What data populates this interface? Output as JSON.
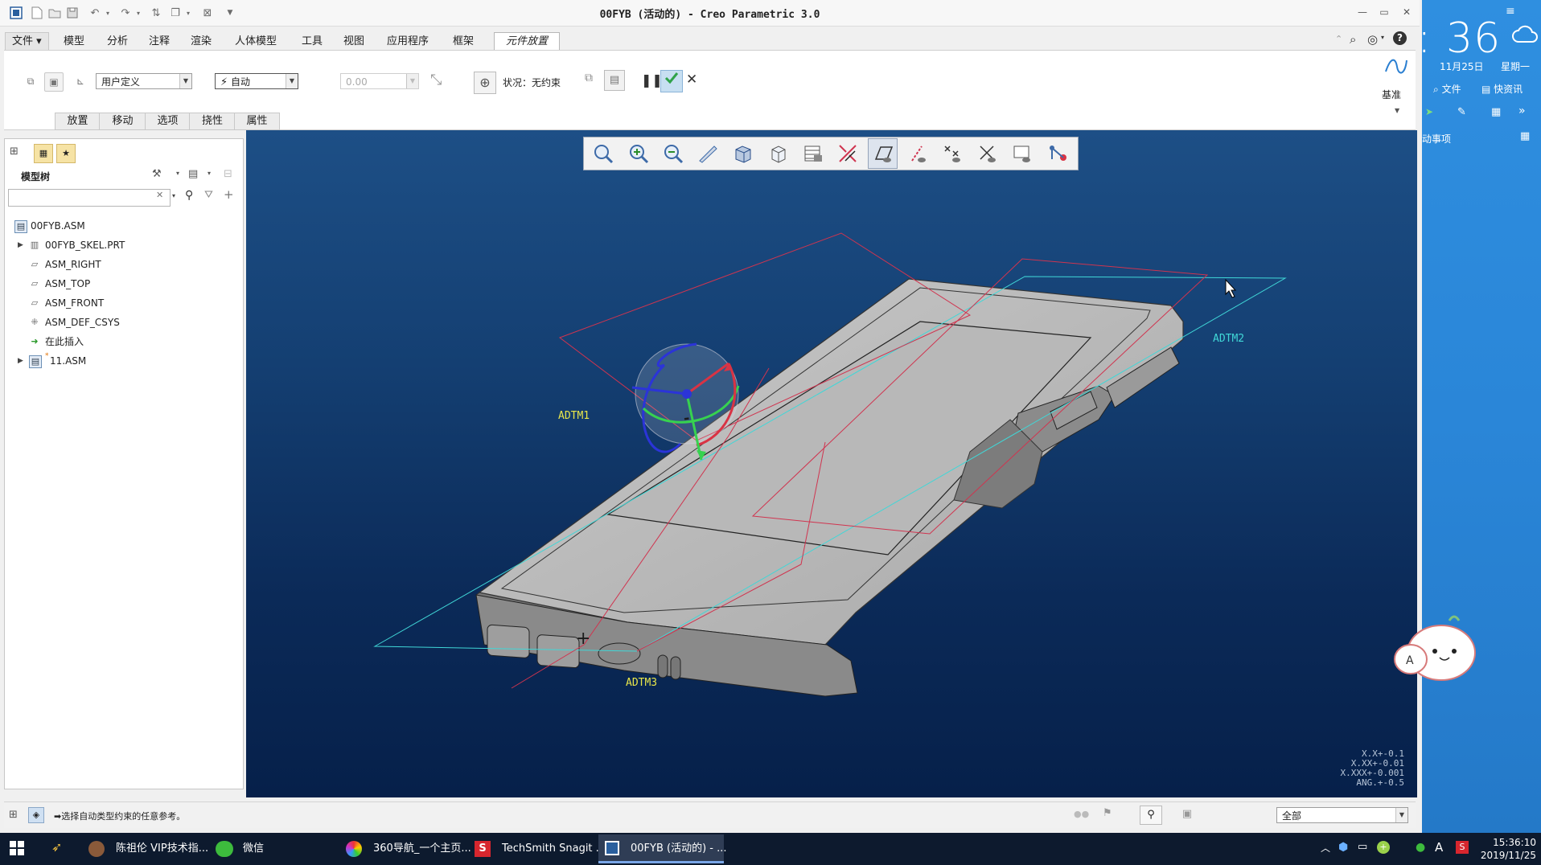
{
  "window": {
    "title": "00FYB (活动的) - Creo Parametric 3.0"
  },
  "menu_tabs": [
    "文件",
    "模型",
    "分析",
    "注释",
    "渲染",
    "人体模型",
    "工具",
    "视图",
    "应用程序",
    "框架",
    "元件放置"
  ],
  "ribbon": {
    "constraint_type_value": "用户定义",
    "constraint_value": "自动",
    "offset_value": "0.00",
    "status_label": "状况：无约束",
    "datum_label": "基准"
  },
  "sub_tabs": [
    "放置",
    "移动",
    "选项",
    "挠性",
    "属性"
  ],
  "model_tree": {
    "title": "模型树",
    "items": [
      {
        "label": "00FYB.ASM"
      },
      {
        "label": "00FYB_SKEL.PRT"
      },
      {
        "label": "ASM_RIGHT"
      },
      {
        "label": "ASM_TOP"
      },
      {
        "label": "ASM_FRONT"
      },
      {
        "label": "ASM_DEF_CSYS"
      },
      {
        "label": "在此插入"
      },
      {
        "label": "11.ASM"
      }
    ]
  },
  "viewport": {
    "datum_labels": {
      "adtm1": "ADTM1",
      "adtm2": "ADTM2",
      "adtm3": "ADTM3"
    },
    "tolerance": [
      "X.X+-0.1",
      "X.XX+-0.01",
      "X.XXX+-0.001",
      "ANG.+-0.5"
    ],
    "key_minus": "-",
    "key_plus": "+"
  },
  "statusbar": {
    "message": "➡选择自动类型约束的任意参考。",
    "filter_value": "全部"
  },
  "taskbar": {
    "items": [
      "陈祖伦 VIP技术指...",
      "微信",
      "360导航_一个主页...",
      "TechSmith Snagit ...",
      "00FYB (活动的) - ..."
    ],
    "time": "15:36:10",
    "date": "2019/11/25",
    "ime": "A"
  },
  "sidebar": {
    "clock": ": 36",
    "date": "11月25日",
    "weekday": "星期一",
    "file_btn": "文件",
    "news_btn": "快资讯",
    "todo": "动事项"
  },
  "colors": {
    "viewport_top": "#1d4f86",
    "viewport_bottom": "#06204a",
    "datum_plane": "#d0344f",
    "datum_cyan": "#40d7d7",
    "datum_text": "#e8e64a",
    "accept_green": "#2fa24a",
    "sidebar_blue": "#2a86d8"
  }
}
